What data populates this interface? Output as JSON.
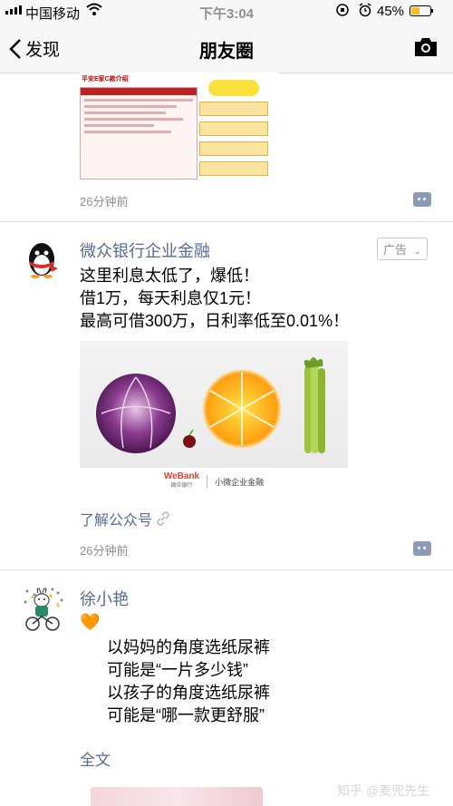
{
  "status_bar": {
    "carrier": "中国移动",
    "time": "下午3:04",
    "battery": "45%",
    "battery_level": 0.45,
    "icons": [
      "signal-icon",
      "wifi-icon",
      "rotation-lock-icon",
      "alarm-icon",
      "battery-icon"
    ]
  },
  "nav": {
    "back_label": "发现",
    "title": "朋友圈",
    "camera_icon": "camera-icon"
  },
  "posts": [
    {
      "image_title": "平安E家C款介绍",
      "time": "26分钟前"
    },
    {
      "name": "微众银行企业金融",
      "ad_badge": "广告",
      "text": [
        "这里利息太低了，爆低！",
        "借1万，每天利息仅1元！",
        "最高可借300万，日利率低至0.01%！"
      ],
      "image_brand": "WeBank",
      "image_brand_cn": "微众银行",
      "image_tagline": "小微企业金融",
      "link": "了解公众号",
      "time": "26分钟前"
    },
    {
      "name": "徐小艳",
      "emoji": "🧡",
      "text": [
        "以妈妈的角度选纸尿裤",
        "可能是“一片多少钱”",
        "以孩子的角度选纸尿裤",
        "可能是“哪一款更舒服”"
      ],
      "full_text": "全文"
    }
  ],
  "watermark": "知乎 @麦兜先生"
}
